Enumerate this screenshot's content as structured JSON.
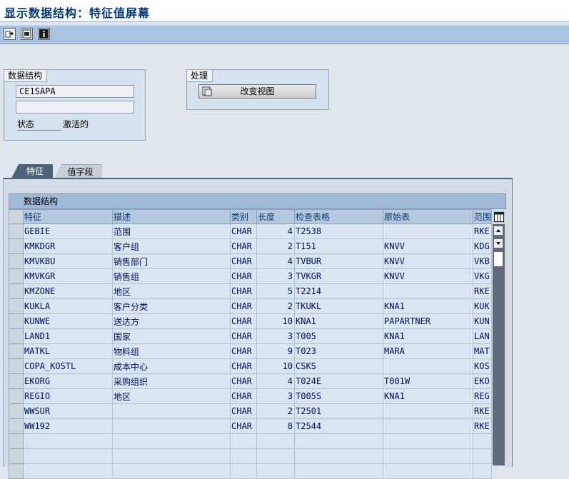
{
  "title": "显示数据结构：特征值屏幕",
  "toolbar": {
    "icons": [
      "other-object-icon",
      "display-object-icon",
      "info-icon"
    ]
  },
  "data_structure_group": {
    "title": "数据结构",
    "name_value": "CE1SAPA",
    "description_value": "",
    "status_label": "状态",
    "status_value": "激活的"
  },
  "processing_group": {
    "title": "处理",
    "change_view_label": "改变视图"
  },
  "tabs": [
    {
      "label": "特征",
      "active": true
    },
    {
      "label": "值字段",
      "active": false
    }
  ],
  "table": {
    "title": "数据结构",
    "columns": [
      "特征",
      "描述",
      "类别",
      "长度",
      "检查表格",
      "原始表",
      "范围"
    ],
    "rows": [
      {
        "feature": "GEBIE",
        "desc": "范围",
        "type": "CHAR",
        "len": "4",
        "check": "T2538",
        "orig": "",
        "range": "RKE"
      },
      {
        "feature": "KMKDGR",
        "desc": "客户组",
        "type": "CHAR",
        "len": "2",
        "check": "T151",
        "orig": "KNVV",
        "range": "KDG"
      },
      {
        "feature": "KMVKBU",
        "desc": "销售部门",
        "type": "CHAR",
        "len": "4",
        "check": "TVBUR",
        "orig": "KNVV",
        "range": "VKB"
      },
      {
        "feature": "KMVKGR",
        "desc": "销售组",
        "type": "CHAR",
        "len": "3",
        "check": "TVKGR",
        "orig": "KNVV",
        "range": "VKG"
      },
      {
        "feature": "KMZONE",
        "desc": "地区",
        "type": "CHAR",
        "len": "5",
        "check": "T2214",
        "orig": "",
        "range": "RKE"
      },
      {
        "feature": "KUKLA",
        "desc": "客户分类",
        "type": "CHAR",
        "len": "2",
        "check": "TKUKL",
        "orig": "KNA1",
        "range": "KUK"
      },
      {
        "feature": "KUNWE",
        "desc": "送达方",
        "type": "CHAR",
        "len": "10",
        "check": "KNA1",
        "orig": "PAPARTNER",
        "range": "KUN"
      },
      {
        "feature": "LAND1",
        "desc": "国家",
        "type": "CHAR",
        "len": "3",
        "check": "T005",
        "orig": "KNA1",
        "range": "LAN"
      },
      {
        "feature": "MATKL",
        "desc": "物料组",
        "type": "CHAR",
        "len": "9",
        "check": "T023",
        "orig": "MARA",
        "range": "MAT"
      },
      {
        "feature": "COPA_KOSTL",
        "desc": "成本中心",
        "type": "CHAR",
        "len": "10",
        "check": "CSKS",
        "orig": "",
        "range": "KOS"
      },
      {
        "feature": "EKORG",
        "desc": "采购组织",
        "type": "CHAR",
        "len": "4",
        "check": "T024E",
        "orig": "T001W",
        "range": "EKO"
      },
      {
        "feature": "REGIO",
        "desc": "地区",
        "type": "CHAR",
        "len": "3",
        "check": "T005S",
        "orig": "KNA1",
        "range": "REG"
      },
      {
        "feature": "WWSUR",
        "desc": "",
        "type": "CHAR",
        "len": "2",
        "check": "T2501",
        "orig": "",
        "range": "RKE"
      },
      {
        "feature": "WW192",
        "desc": "",
        "type": "CHAR",
        "len": "8",
        "check": "T2544",
        "orig": "",
        "range": "RKE"
      },
      {
        "feature": "",
        "desc": "",
        "type": "",
        "len": "",
        "check": "",
        "orig": "",
        "range": ""
      },
      {
        "feature": "",
        "desc": "",
        "type": "",
        "len": "",
        "check": "",
        "orig": "",
        "range": ""
      },
      {
        "feature": "",
        "desc": "",
        "type": "",
        "len": "",
        "check": "",
        "orig": "",
        "range": ""
      }
    ]
  },
  "colors": {
    "toolbar": "#a9c3e2",
    "title_text": "#003a7a",
    "active_tab": "#4d6478",
    "table_cell": "#d9e5f1",
    "table_header": "#b4c8de"
  }
}
